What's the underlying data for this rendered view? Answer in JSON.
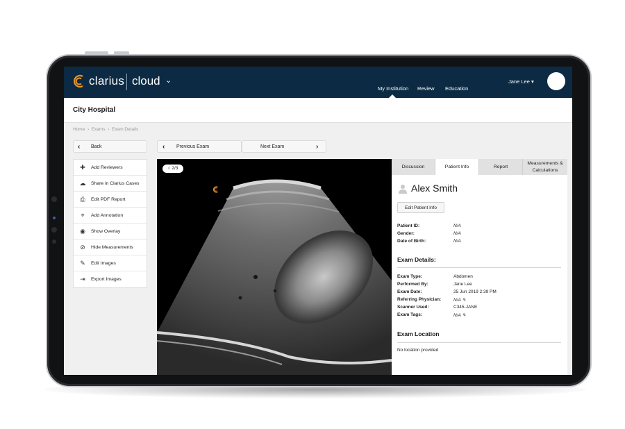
{
  "header": {
    "brand": "clarius",
    "product": "cloud",
    "nav": [
      "My Institution",
      "Review",
      "Education"
    ],
    "user": "Jane Lee"
  },
  "institution": "City Hospital",
  "breadcrumb": [
    "Home",
    "Exams",
    "Exam Details"
  ],
  "buttons": {
    "back": "Back",
    "previous": "Previous Exam",
    "next": "Next Exam"
  },
  "actions": [
    {
      "label": "Add Reviewers",
      "icon": "add-reviewer-icon"
    },
    {
      "label": "Share in Clarius Cases",
      "icon": "cloud-upload-icon"
    },
    {
      "label": "Edit PDF Report",
      "icon": "printer-icon"
    },
    {
      "label": "Add Annotation",
      "icon": "pin-icon"
    },
    {
      "label": "Show Overlay",
      "icon": "eye-icon"
    },
    {
      "label": "Hide Measurements",
      "icon": "eye-slash-icon"
    },
    {
      "label": "Edit Images",
      "icon": "pencil-icon"
    },
    {
      "label": "Export Images",
      "icon": "export-icon"
    }
  ],
  "viewer": {
    "counter": "2/3"
  },
  "tabs": [
    {
      "label": "Discussion",
      "active": false
    },
    {
      "label": "Patient Info",
      "active": true
    },
    {
      "label": "Report",
      "active": false
    },
    {
      "label": "Measurements & Calculations",
      "active": false
    }
  ],
  "patient": {
    "name": "Alex Smith",
    "edit_label": "Edit Patient Info",
    "fields": [
      {
        "label": "Patient ID:",
        "value": "N/A"
      },
      {
        "label": "Gender:",
        "value": "N/A"
      },
      {
        "label": "Date of Birth:",
        "value": "N/A"
      }
    ]
  },
  "exam": {
    "title": "Exam Details:",
    "fields": [
      {
        "label": "Exam Type:",
        "value": "Abdomen"
      },
      {
        "label": "Performed By:",
        "value": "Jane Lee"
      },
      {
        "label": "Exam Date:",
        "value": "25 Jun 2019 2:39 PM"
      },
      {
        "label": "Referring Physician:",
        "value": "N/A"
      },
      {
        "label": "Scanner Used:",
        "value": "C345-JANE"
      },
      {
        "label": "Exam Tags:",
        "value": "N/A"
      }
    ]
  },
  "location": {
    "title": "Exam Location",
    "value": "No location provided"
  },
  "colors": {
    "header": "#0c2a43",
    "brand_accent": "#e8942a"
  }
}
